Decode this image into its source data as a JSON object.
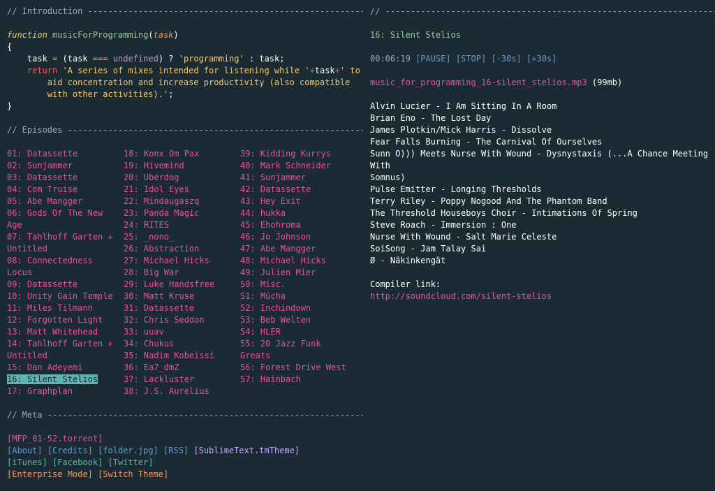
{
  "headers": {
    "intro": "// Introduction -------------------------------------------------------",
    "episodes": "// Episodes -------------------------------------------------------------",
    "meta": "// Meta -----------------------------------------------------------------",
    "right": "// -------------------------------------------------------------------------"
  },
  "code": {
    "kw_function": "function",
    "fname": "musicForProgramming",
    "param": "task",
    "lbrace": "{",
    "rbrace": "}",
    "l1_task": "task",
    "l1_eq": "=",
    "l1_open": "(task",
    "l1_teq": "===",
    "l1_undef": "undefined",
    "l1_rest1": ") ?",
    "l1_str": "'programming'",
    "l1_rest2": ": task;",
    "kw_return": "return",
    "l2_str1": "'A series of mixes intended for listening while '",
    "plus1": "+",
    "l2_task": "task",
    "plus2": "+",
    "l2_str2": "' to",
    "l3_str": "aid concentration and increase productivity (also compatible",
    "l4_str": "with other activities).'",
    "l4_end": ";"
  },
  "episodes": {
    "col1": [
      "01: Datassette",
      "02: Sunjammer",
      "03: Datassette",
      "04: Com Truise",
      "05: Abe Mangger",
      "06: Gods Of The New",
      "Age",
      "07: Tahlhoff Garten +",
      "Untitled",
      "08: Connectedness",
      "Locus",
      "09: Datassette",
      "10: Unity Gain Temple",
      "11: Miles Tilmann",
      "12: Forgotten Light",
      "13: Matt Whitehead",
      "14: Tahlhoff Garten +",
      "Untitled",
      "15: Dan Adeyemi",
      "16: Silent Stelios",
      "17: Graphplan"
    ],
    "col2": [
      "18: Konx Om Pax",
      "19: Hivemind",
      "20: Uberdog",
      "21: Idol Eyes",
      "22: Mindaugaszq",
      "23: Panda Magic",
      "24: RITES",
      "25: _nono_",
      "26: Abstraction",
      "27: Michael Hicks",
      "28: Big War",
      "29: Luke Handsfree",
      "30: Matt Kruse",
      "31: Datassette",
      "32: Chris Seddon",
      "33: uuav",
      "34: Chukus",
      "35: Nadim Kobeissi",
      "36: Ea7_dmZ",
      "37: Lackluster",
      "38: J.S. Aurelius"
    ],
    "col3": [
      "39: Kidding Kurrys",
      "40: Mark Schneider",
      "41: Sunjammer",
      "42: Datassette",
      "43: Hey Exit",
      "44: hukka",
      "45: Ehohroma",
      "46: Jo Johnson",
      "47: Abe Mangger",
      "48: Michael Hicks",
      "49: Julien Mier",
      "50: Misc.",
      "51: Mücha",
      "52: Inchindown",
      "53: Beb Welten",
      "54: HLER",
      "55: 20 Jazz Funk",
      "Greats",
      "56: Forest Drive West",
      "57: Hainbach"
    ],
    "selected": "16: Silent Stelios"
  },
  "meta": {
    "torrent": "[MFP_01-52.torrent]",
    "row2": [
      "[About]",
      "[Credits]",
      "[folder.jpg]",
      "[RSS]",
      "[SublimeText.tmTheme]"
    ],
    "row3": [
      "[iTunes]",
      "[Facebook]",
      "[Twitter]"
    ],
    "row4": [
      "[Enterprise Mode]",
      "[Switch Theme]"
    ]
  },
  "player": {
    "title": "16: Silent Stelios",
    "time": "00:06:19",
    "pause": "[PAUSE]",
    "stop": "[STOP]",
    "back": "[-30s]",
    "fwd": "[+30s]",
    "file": "music_for_programming_16-silent_stelios.mp3",
    "size": "(99mb)"
  },
  "tracklist": [
    "Alvin Lucier - I Am Sitting In A Room",
    "Brian Eno - The Lost Day",
    "James Plotkin/Mick Harris - Dissolve",
    "Fear Falls Burning - The Carnival Of Ourselves",
    "Sunn O))) Meets Nurse With Wound - Dysnystaxis (...A Chance Meeting With",
    "Somnus)",
    "Pulse Emitter - Longing Thresholds",
    "Terry Riley - Poppy Nogood And The Phantom Band",
    "The Threshold Houseboys Choir - Intimations Of Spring",
    "Steve Roach - Immersion : One",
    "Nurse With Wound - Salt Marie Celeste",
    "SoiSong - Jam Talay Sai",
    "Ø - Näkinkengät"
  ],
  "compiler": {
    "label": "Compiler link:",
    "url": "http://soundcloud.com/silent-stelios"
  }
}
